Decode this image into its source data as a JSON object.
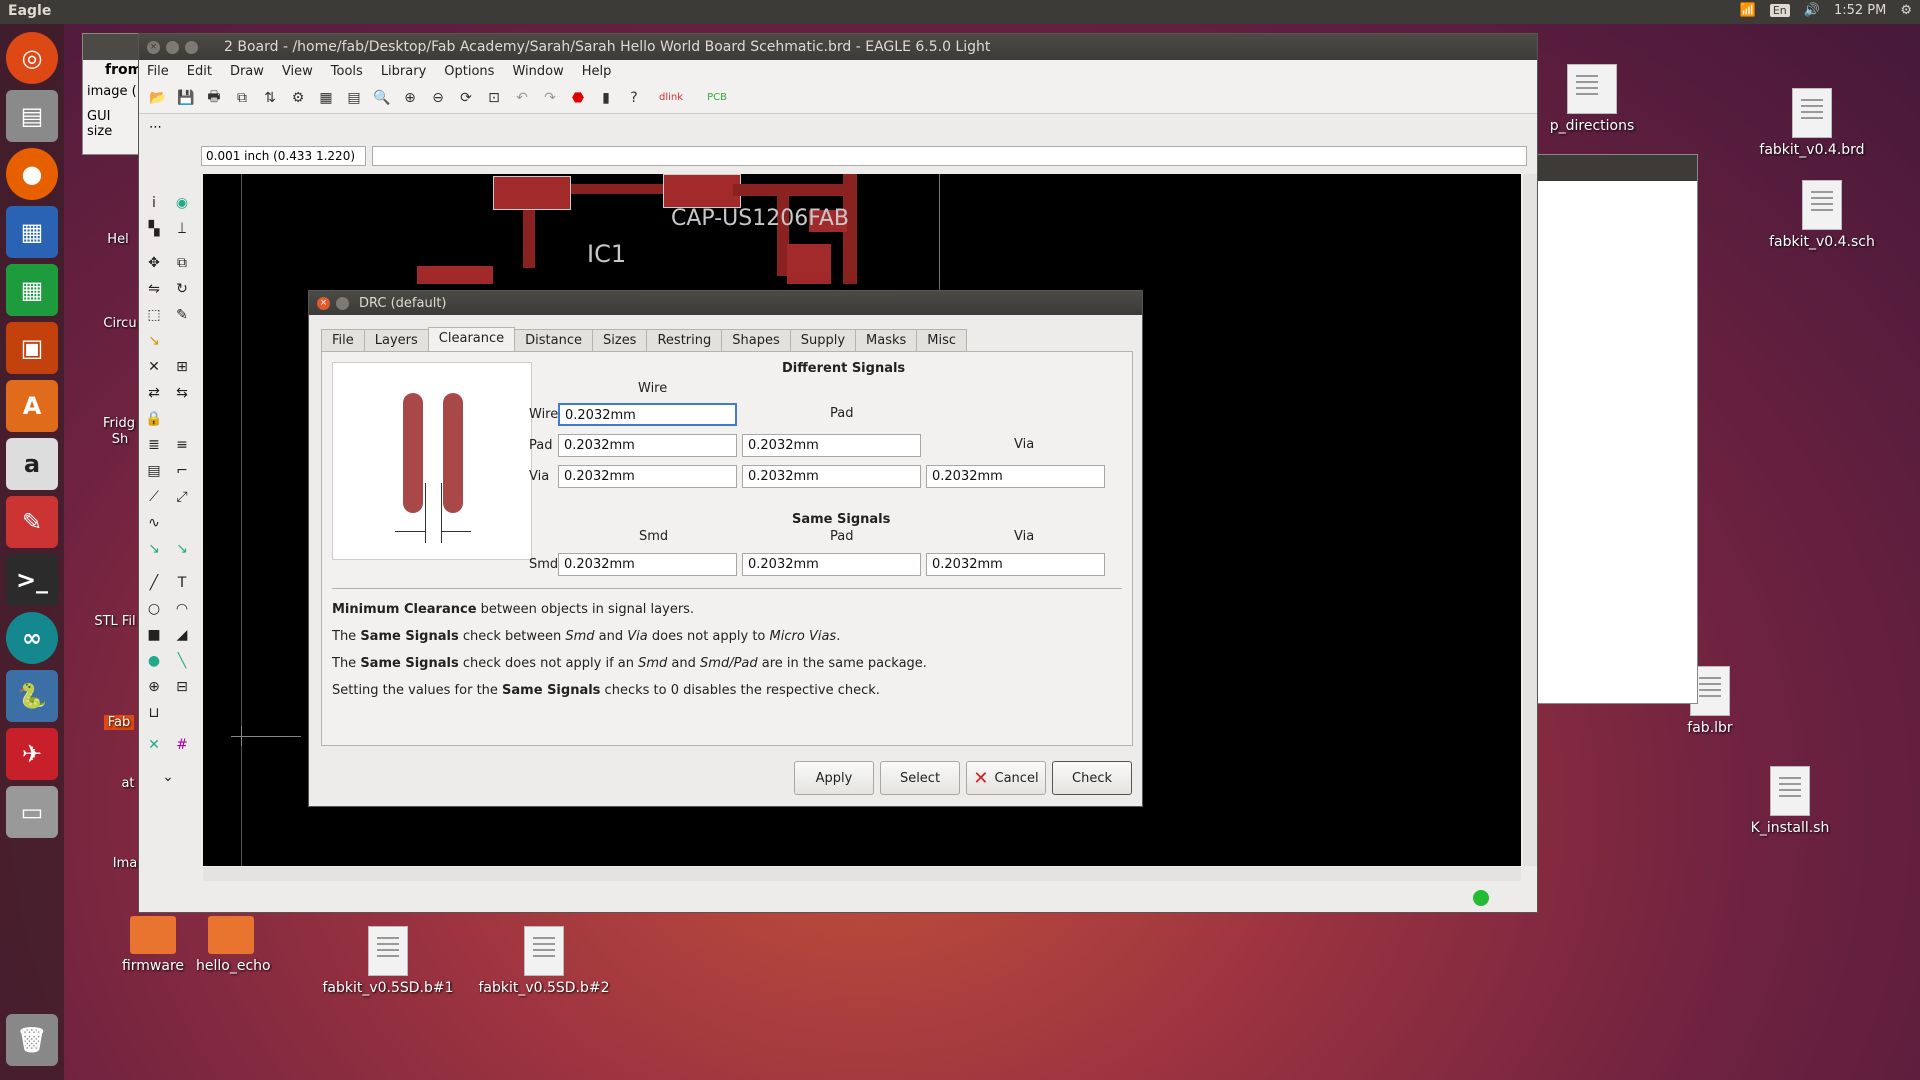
{
  "topbar": {
    "app": "Eagle",
    "lang": "En",
    "time": "1:52 PM"
  },
  "desktop_icons": [
    "fabkit_v0.4.brd",
    "fabkit_v0.4.sch",
    "fab.lbr",
    "K_install.sh",
    "firmware",
    "hello_echo",
    "fabkit_v0.5SD.b#1",
    "fabkit_v0.5SD.b#2",
    "p_directions"
  ],
  "bg_window": {
    "from": "from",
    "image": "image (",
    "gui": "GUI size",
    "labels": [
      "Hel",
      "Circu",
      "Fridg",
      "Sh",
      "STL Fil",
      "Fab",
      "at",
      "Ima"
    ]
  },
  "eagle": {
    "title": "2 Board - /home/fab/Desktop/Fab Academy/Sarah/Sarah Hello World Board Scehmatic.brd - EAGLE 6.5.0 Light",
    "menu": [
      "File",
      "Edit",
      "Draw",
      "View",
      "Tools",
      "Library",
      "Options",
      "Window",
      "Help"
    ],
    "coord": "0.001 inch (0.433 1.220)",
    "canvas_labels": {
      "cap": "CAP-US1206FAB",
      "ic": "IC1"
    }
  },
  "drc": {
    "title": "DRC (default)",
    "tabs": [
      "File",
      "Layers",
      "Clearance",
      "Distance",
      "Sizes",
      "Restring",
      "Shapes",
      "Supply",
      "Masks",
      "Misc"
    ],
    "different_signals": "Different Signals",
    "same_signals": "Same Signals",
    "col_wire": "Wire",
    "col_pad": "Pad",
    "col_via": "Via",
    "col_smd": "Smd",
    "row_wire": "Wire",
    "row_pad": "Pad",
    "row_via": "Via",
    "row_smd": "Smd",
    "values": {
      "wire_wire": "0.2032mm",
      "pad_wire": "0.2032mm",
      "pad_pad": "0.2032mm",
      "via_wire": "0.2032mm",
      "via_pad": "0.2032mm",
      "via_via": "0.2032mm",
      "smd_smd": "0.2032mm",
      "smd_pad": "0.2032mm",
      "smd_via": "0.2032mm"
    },
    "notes": {
      "n1b": "Minimum Clearance",
      "n1": " between objects in signal layers.",
      "n2a": "The ",
      "n2b": "Same Signals",
      "n2c": " check between ",
      "n2d": "Smd",
      "n2e": " and ",
      "n2f": "Via",
      "n2g": " does not apply to ",
      "n2h": "Micro Vias",
      ".": ".",
      "n3a": "The ",
      "n3b": "Same Signals",
      "n3c": " check does not apply if an ",
      "n3d": "Smd",
      "n3e": " and ",
      "n3f": "Smd/Pad",
      "n3g": " are in the same package.",
      "n4a": "Setting the values for the ",
      "n4b": "Same Signals",
      "n4c": " checks to 0 disables the respective check."
    },
    "buttons": {
      "apply": "Apply",
      "select": "Select",
      "cancel": "Cancel",
      "check": "Check"
    }
  }
}
